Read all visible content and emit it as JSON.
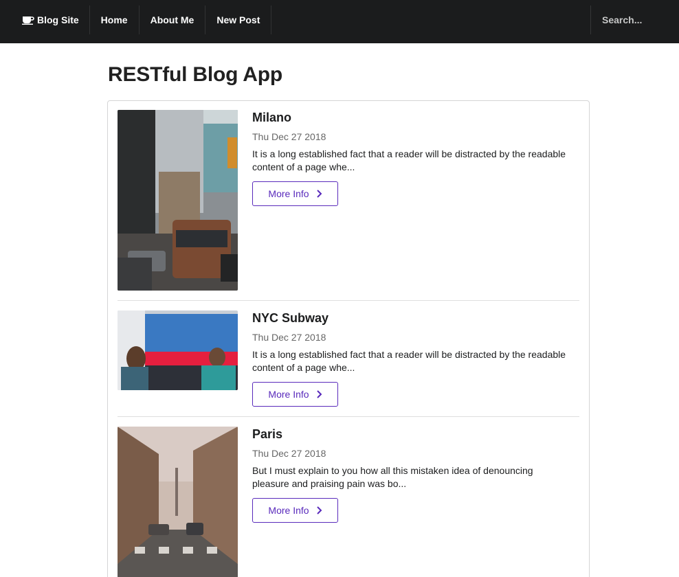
{
  "nav": {
    "brand": "Blog Site",
    "items": [
      "Home",
      "About Me",
      "New Post"
    ],
    "search_placeholder": "Search..."
  },
  "page": {
    "title": "RESTful Blog App"
  },
  "posts": [
    {
      "title": "Milano",
      "date": "Thu Dec 27 2018",
      "excerpt": "It is a long established fact that a reader will be distracted by the readable content of a page whe...",
      "button": "More Info"
    },
    {
      "title": "NYC Subway",
      "date": "Thu Dec 27 2018",
      "excerpt": "It is a long established fact that a reader will be distracted by the readable content of a page whe...",
      "button": "More Info"
    },
    {
      "title": "Paris",
      "date": "Thu Dec 27 2018",
      "excerpt": "But I must explain to you how all this mistaken idea of denouncing pleasure and praising pain was bo...",
      "button": "More Info"
    }
  ],
  "colors": {
    "nav_bg": "#1b1c1d",
    "accent": "#5829bb",
    "border": "#d4d4d5"
  },
  "icons": {
    "brand": "coffee-icon",
    "button": "chevron-right-icon"
  }
}
